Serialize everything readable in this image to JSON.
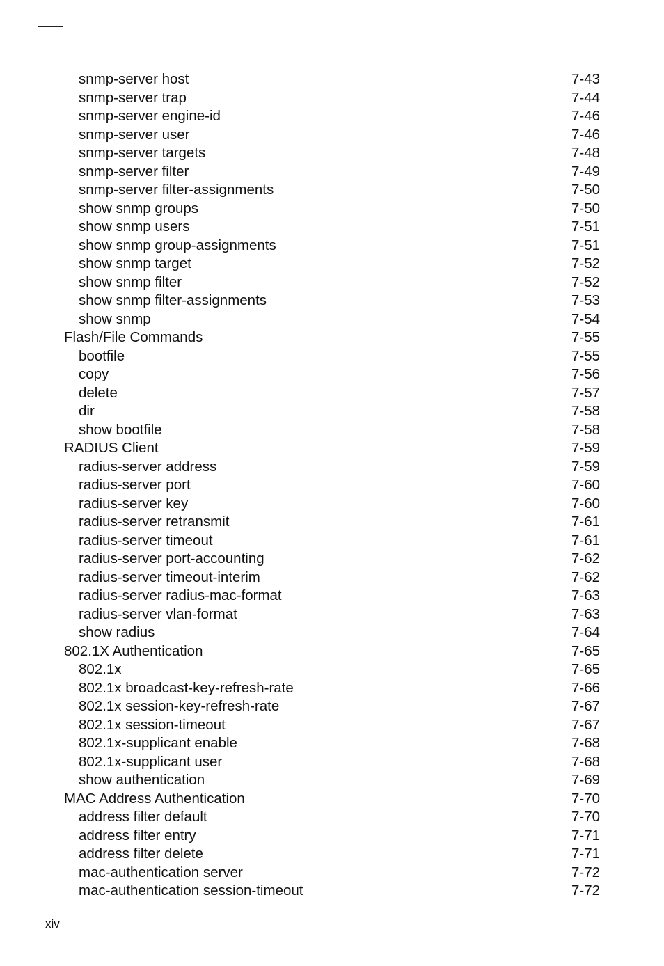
{
  "document": {
    "folio": "xiv",
    "toc_entries": [
      {
        "label": "snmp-server host",
        "page": "7-43",
        "level": 2
      },
      {
        "label": "snmp-server trap",
        "page": "7-44",
        "level": 2
      },
      {
        "label": "snmp-server engine-id",
        "page": "7-46",
        "level": 2
      },
      {
        "label": "snmp-server user",
        "page": "7-46",
        "level": 2
      },
      {
        "label": "snmp-server targets",
        "page": "7-48",
        "level": 2
      },
      {
        "label": "snmp-server filter",
        "page": "7-49",
        "level": 2
      },
      {
        "label": "snmp-server filter-assignments",
        "page": "7-50",
        "level": 2
      },
      {
        "label": "show snmp groups",
        "page": "7-50",
        "level": 2
      },
      {
        "label": "show snmp users",
        "page": "7-51",
        "level": 2
      },
      {
        "label": "show snmp group-assignments",
        "page": "7-51",
        "level": 2
      },
      {
        "label": "show snmp target",
        "page": "7-52",
        "level": 2
      },
      {
        "label": "show snmp filter",
        "page": "7-52",
        "level": 2
      },
      {
        "label": "show snmp filter-assignments",
        "page": "7-53",
        "level": 2
      },
      {
        "label": "show snmp",
        "page": "7-54",
        "level": 2
      },
      {
        "label": "Flash/File Commands",
        "page": "7-55",
        "level": 1
      },
      {
        "label": "bootfile",
        "page": "7-55",
        "level": 2
      },
      {
        "label": "copy",
        "page": "7-56",
        "level": 2
      },
      {
        "label": "delete",
        "page": "7-57",
        "level": 2
      },
      {
        "label": "dir",
        "page": "7-58",
        "level": 2
      },
      {
        "label": "show bootfile",
        "page": "7-58",
        "level": 2
      },
      {
        "label": "RADIUS Client",
        "page": "7-59",
        "level": 1
      },
      {
        "label": "radius-server address",
        "page": "7-59",
        "level": 2
      },
      {
        "label": "radius-server port",
        "page": "7-60",
        "level": 2
      },
      {
        "label": "radius-server key",
        "page": "7-60",
        "level": 2
      },
      {
        "label": "radius-server retransmit",
        "page": "7-61",
        "level": 2
      },
      {
        "label": "radius-server timeout",
        "page": "7-61",
        "level": 2
      },
      {
        "label": "radius-server port-accounting",
        "page": "7-62",
        "level": 2
      },
      {
        "label": "radius-server timeout-interim",
        "page": "7-62",
        "level": 2
      },
      {
        "label": "radius-server radius-mac-format",
        "page": "7-63",
        "level": 2
      },
      {
        "label": "radius-server vlan-format",
        "page": "7-63",
        "level": 2
      },
      {
        "label": "show radius",
        "page": "7-64",
        "level": 2
      },
      {
        "label": "802.1X Authentication",
        "page": "7-65",
        "level": 1
      },
      {
        "label": "802.1x",
        "page": "7-65",
        "level": 2
      },
      {
        "label": "802.1x broadcast-key-refresh-rate",
        "page": "7-66",
        "level": 2
      },
      {
        "label": "802.1x session-key-refresh-rate",
        "page": "7-67",
        "level": 2
      },
      {
        "label": "802.1x session-timeout",
        "page": "7-67",
        "level": 2
      },
      {
        "label": "802.1x-supplicant enable",
        "page": "7-68",
        "level": 2
      },
      {
        "label": "802.1x-supplicant user",
        "page": "7-68",
        "level": 2
      },
      {
        "label": "show authentication",
        "page": "7-69",
        "level": 2
      },
      {
        "label": "MAC Address Authentication",
        "page": "7-70",
        "level": 1
      },
      {
        "label": "address filter default",
        "page": "7-70",
        "level": 2
      },
      {
        "label": "address filter entry",
        "page": "7-71",
        "level": 2
      },
      {
        "label": "address filter delete",
        "page": "7-71",
        "level": 2
      },
      {
        "label": "mac-authentication server",
        "page": "7-72",
        "level": 2
      },
      {
        "label": "mac-authentication session-timeout",
        "page": "7-72",
        "level": 2
      }
    ]
  }
}
